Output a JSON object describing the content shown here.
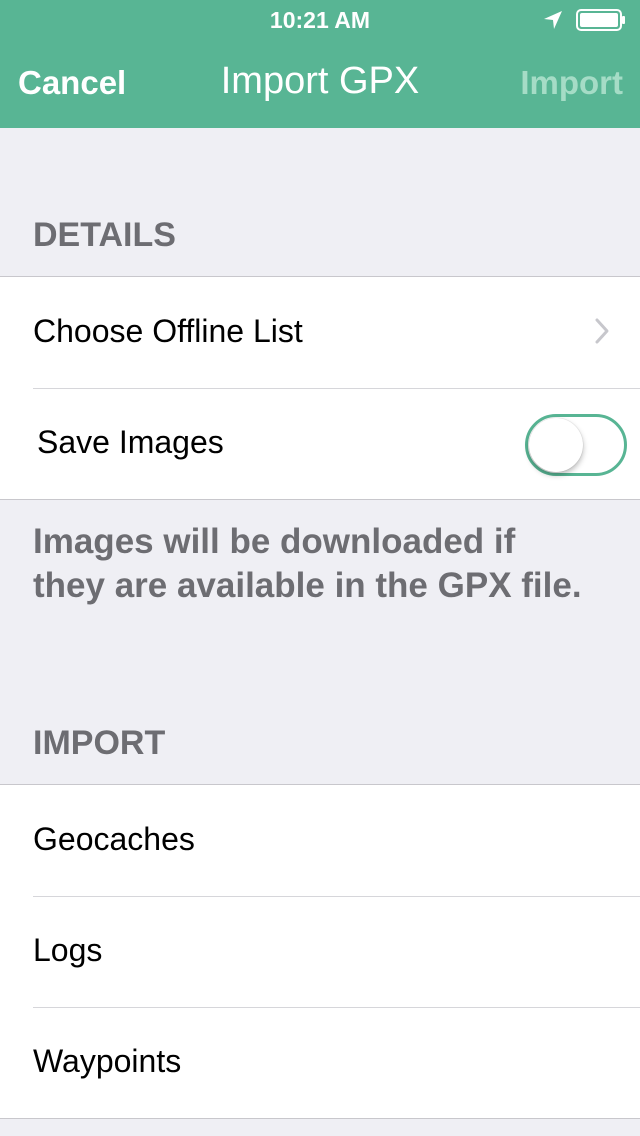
{
  "status_bar": {
    "time": "10:21 AM"
  },
  "nav": {
    "cancel_label": "Cancel",
    "title": "Import GPX",
    "import_label": "Import"
  },
  "details": {
    "header": "DETAILS",
    "choose_list_label": "Choose Offline List",
    "save_images_label": "Save Images",
    "save_images_on": false,
    "footer": "Images will be downloaded if they are available in the GPX file."
  },
  "import": {
    "header": "IMPORT",
    "items": [
      {
        "label": "Geocaches"
      },
      {
        "label": "Logs"
      },
      {
        "label": "Waypoints"
      }
    ]
  },
  "colors": {
    "accent": "#58b594",
    "background": "#efeff4",
    "disabled_nav_text": "#a5dcc6"
  },
  "icons": [
    "location-arrow-icon",
    "battery-icon",
    "chevron-right-icon"
  ]
}
